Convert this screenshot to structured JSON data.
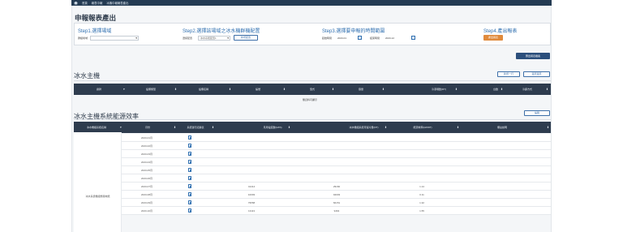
{
  "topbar": {
    "crumb1": "首頁",
    "crumb2": "報表中報",
    "crumb3": "冰機中報報表產出"
  },
  "page_title": "申報報表產出",
  "step1": {
    "title": "Step1.選擇場域",
    "label": "群組場域",
    "selected": ""
  },
  "step2": {
    "title": "Step2.選擇該場域之冰水機群機配置",
    "label": "選擇配置",
    "selected": "冰水系統配置1",
    "button": "新增配置"
  },
  "step3": {
    "title": "Step3.選擇要申報的時間範圍",
    "start_label": "起始時間",
    "start": "2023-01",
    "end_label": "結束時間",
    "end": "2023-12"
  },
  "step4": {
    "title": "Step4.產出報表",
    "button": "產出報表"
  },
  "export_button": "匯出報表檔案",
  "chiller": {
    "title": "冰水主機",
    "add_button": "新增一行",
    "reset_button": "還原還原",
    "columns": [
      "廠牌",
      "設備類型",
      "設備名稱",
      "編號",
      "型式",
      "容量",
      "冷凍噸數(RT)",
      "台數",
      "冷卻方式"
    ],
    "empty_text": "無資料可顯示"
  },
  "efficiency": {
    "title": "冰水主機系統能源效率",
    "edit_button": "編輯",
    "columns": [
      "冰水機組系統名稱",
      "月份",
      "系統運行記錄表",
      "月用電度數(kWh)",
      "冰水機組系統月製冷量(RT)",
      "能源效率(kW/RT)",
      "備註說明"
    ],
    "system_name": "冰水系統機組整體效能",
    "rows": [
      {
        "month": "2023-01月",
        "kwh": "",
        "rt": "",
        "eff": ""
      },
      {
        "month": "2023-02月",
        "kwh": "",
        "rt": "",
        "eff": ""
      },
      {
        "month": "2023-03月",
        "kwh": "",
        "rt": "",
        "eff": ""
      },
      {
        "month": "2023-04月",
        "kwh": "",
        "rt": "",
        "eff": ""
      },
      {
        "month": "2023-05月",
        "kwh": "",
        "rt": "",
        "eff": ""
      },
      {
        "month": "2023-06月",
        "kwh": "",
        "rt": "",
        "eff": ""
      },
      {
        "month": "2023-07月",
        "kwh": "41414",
        "rt": "29160",
        "eff": "1.14"
      },
      {
        "month": "2023-08月",
        "kwh": "10093",
        "rt": "94003",
        "eff": "0.11"
      },
      {
        "month": "2023-09月",
        "kwh": "79558",
        "rt": "60151",
        "eff": "1.32"
      },
      {
        "month": "2023-10月",
        "kwh": "13113",
        "rt": "9464",
        "eff": "1.55"
      }
    ]
  }
}
